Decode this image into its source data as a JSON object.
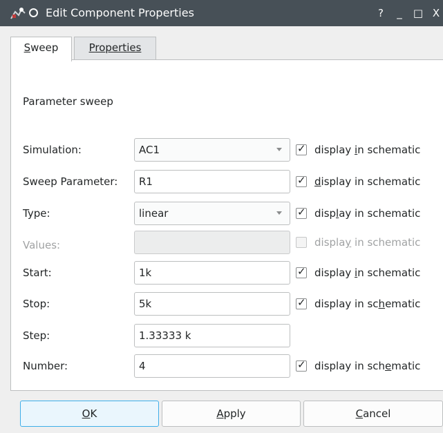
{
  "window": {
    "title": "Edit Component Properties",
    "help": "?",
    "minimize": "_",
    "maximize": "□",
    "close": "X"
  },
  "tabs": [
    {
      "mnemonic": "S",
      "rest": "weep"
    },
    {
      "mnemonic": "P",
      "rest": "roperties"
    }
  ],
  "section_label": "Parameter sweep",
  "rows": [
    {
      "label": "Simulation:",
      "value": "AC1",
      "combo": true,
      "checked": true,
      "chk_pre": "display ",
      "chk_mn": "i",
      "chk_post": "n schematic"
    },
    {
      "label": "Sweep Parameter:",
      "value": "R1",
      "combo": false,
      "checked": true,
      "chk_pre": "",
      "chk_mn": "d",
      "chk_post": "isplay in schematic"
    },
    {
      "label": "Type:",
      "value": "linear",
      "combo": true,
      "checked": true,
      "chk_pre": "disp",
      "chk_mn": "l",
      "chk_post": "ay in schematic"
    },
    {
      "label": "Values:",
      "value": "",
      "combo": false,
      "checked": false,
      "disabled": true,
      "chk_pre": "displa",
      "chk_mn": "y",
      "chk_post": " in schematic"
    },
    {
      "label": "Start:",
      "value": "1k",
      "combo": false,
      "checked": true,
      "chk_pre": "display ",
      "chk_mn": "i",
      "chk_post": "n schematic"
    },
    {
      "label": "Stop:",
      "value": "5k",
      "combo": false,
      "checked": true,
      "chk_pre": "display in sc",
      "chk_mn": "h",
      "chk_post": "ematic"
    },
    {
      "label": "Step:",
      "value": "1.33333 k",
      "combo": false
    },
    {
      "label": "Number:",
      "value": "4",
      "combo": false,
      "checked": true,
      "chk_pre": "display in sch",
      "chk_mn": "e",
      "chk_post": "matic"
    }
  ],
  "buttons": {
    "ok": {
      "mnemonic": "O",
      "rest": "K"
    },
    "apply": {
      "mnemonic": "A",
      "rest": "pply"
    },
    "cancel": {
      "mnemonic": "C",
      "rest": "ancel"
    }
  },
  "colors": {
    "titlebar": "#475057",
    "accent": "#3daee9"
  }
}
